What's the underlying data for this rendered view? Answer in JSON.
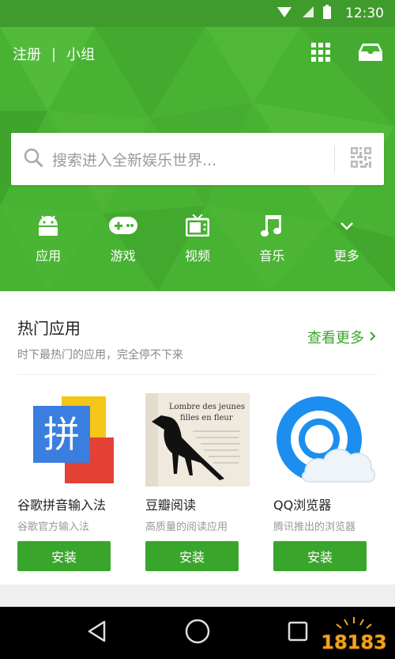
{
  "status_bar": {
    "time": "12:30"
  },
  "top_bar": {
    "register": "注册",
    "separator": "|",
    "group": "小组"
  },
  "search": {
    "placeholder": "搜索进入全新娱乐世界..."
  },
  "categories": [
    {
      "label": "应用",
      "icon": "android-icon"
    },
    {
      "label": "游戏",
      "icon": "gamepad-icon"
    },
    {
      "label": "视频",
      "icon": "tv-icon"
    },
    {
      "label": "音乐",
      "icon": "music-note-icon"
    },
    {
      "label": "更多",
      "icon": "chevron-down-icon"
    }
  ],
  "hot_apps": {
    "title": "热门应用",
    "subtitle": "时下最热门的应用，完全停不下来",
    "more_label": "查看更多",
    "apps": [
      {
        "name": "谷歌拼音输入法",
        "desc": "谷歌官方输入法",
        "install_label": "安装",
        "icon_char": "拼"
      },
      {
        "name": "豆瓣阅读",
        "desc": "高质量的阅读应用",
        "install_label": "安装",
        "cover_line1": "Lombre des jeunes",
        "cover_line2": "filles en fleur"
      },
      {
        "name": "QQ浏览器",
        "desc": "腾讯推出的浏览器",
        "install_label": "安装"
      }
    ]
  },
  "watermark": {
    "text": "18183"
  },
  "colors": {
    "brand_green": "#48b233",
    "button_green": "#3aa52b"
  }
}
